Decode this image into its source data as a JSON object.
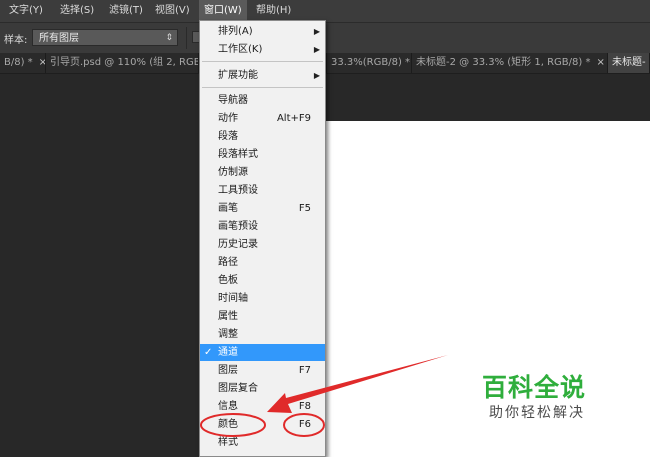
{
  "menubar": {
    "items": [
      "文字(Y)",
      "选择(S)",
      "滤镜(T)",
      "视图(V)",
      "窗口(W)",
      "帮助(H)"
    ]
  },
  "options": {
    "sample_label": "样本:",
    "sample_value": "所有图层"
  },
  "tabs": [
    {
      "label": "B/8) *"
    },
    {
      "label": "引导页.psd @ 110% (组 2, RGB/"
    },
    {
      "label": "33.3%(RGB/8) *"
    },
    {
      "label": "未标题-2 @ 33.3% (矩形 1, RGB/8) *"
    },
    {
      "label": "未标题-"
    }
  ],
  "tab_close_glyph": "×",
  "window_menu": {
    "top_items": [
      {
        "label": "排列(A)",
        "submenu": true
      },
      {
        "label": "工作区(K)",
        "submenu": true
      }
    ],
    "ext_items": [
      {
        "label": "扩展功能",
        "submenu": true
      }
    ],
    "panel_items": [
      {
        "label": "导航器",
        "shortcut": ""
      },
      {
        "label": "动作",
        "shortcut": "Alt+F9"
      },
      {
        "label": "段落",
        "shortcut": ""
      },
      {
        "label": "段落样式",
        "shortcut": ""
      },
      {
        "label": "仿制源",
        "shortcut": ""
      },
      {
        "label": "工具预设",
        "shortcut": ""
      },
      {
        "label": "画笔",
        "shortcut": "F5"
      },
      {
        "label": "画笔预设",
        "shortcut": ""
      },
      {
        "label": "历史记录",
        "shortcut": ""
      },
      {
        "label": "路径",
        "shortcut": ""
      },
      {
        "label": "色板",
        "shortcut": ""
      },
      {
        "label": "时间轴",
        "shortcut": ""
      },
      {
        "label": "属性",
        "shortcut": ""
      },
      {
        "label": "调整",
        "shortcut": ""
      },
      {
        "label": "通道",
        "shortcut": "",
        "checked": true,
        "selected": true
      },
      {
        "label": "图层",
        "shortcut": "F7"
      },
      {
        "label": "图层复合",
        "shortcut": ""
      },
      {
        "label": "信息",
        "shortcut": "F8"
      },
      {
        "label": "颜色",
        "shortcut": "F6"
      },
      {
        "label": "样式",
        "shortcut": ""
      }
    ]
  },
  "check_glyph": "✓",
  "submenu_glyph": "▶",
  "watermark": {
    "title": "百科全说",
    "subtitle": "助你轻松解决"
  },
  "colors": {
    "annotation_red": "#e02a2a",
    "selection_blue": "#3298fb",
    "watermark_green": "#2fae3c"
  }
}
